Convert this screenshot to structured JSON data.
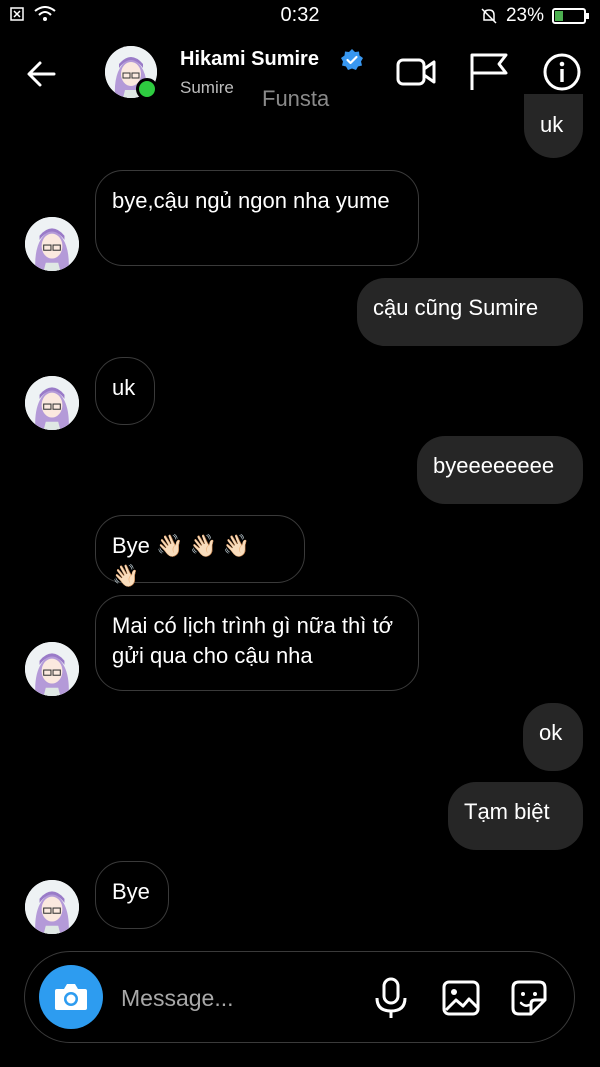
{
  "status_bar": {
    "time": "0:32",
    "battery_text": "23%"
  },
  "header": {
    "name": "Hikami Sumire",
    "subtitle": "Sumire",
    "label": "Funsta",
    "icons": [
      "back-arrow-icon",
      "video-call-icon",
      "flag-icon",
      "info-icon"
    ]
  },
  "messages": [
    {
      "side": "out",
      "text": "uk"
    },
    {
      "side": "in",
      "text": "bye,cậu ngủ ngon nha yume"
    },
    {
      "side": "out",
      "text": "cậu cũng Sumire"
    },
    {
      "side": "in",
      "text": "uk"
    },
    {
      "side": "out",
      "text": "byeeeeeeee"
    },
    {
      "side": "in",
      "text": "Bye",
      "emoji": "👋🏻👋🏻👋🏻👋🏻"
    },
    {
      "side": "in",
      "text": "Mai có lịch trình gì nữa thì tớ gửi qua cho cậu nha"
    },
    {
      "side": "out",
      "text": "ok"
    },
    {
      "side": "out",
      "text": "Tạm biệt"
    },
    {
      "side": "in",
      "text": "Bye"
    }
  ],
  "composer": {
    "placeholder": "Message...",
    "icons": [
      "camera-icon",
      "microphone-icon",
      "gallery-icon",
      "sticker-icon"
    ]
  },
  "colors": {
    "accent": "#2d9cf0",
    "online": "#2ecc40",
    "outgoing_bubble": "#262626"
  }
}
